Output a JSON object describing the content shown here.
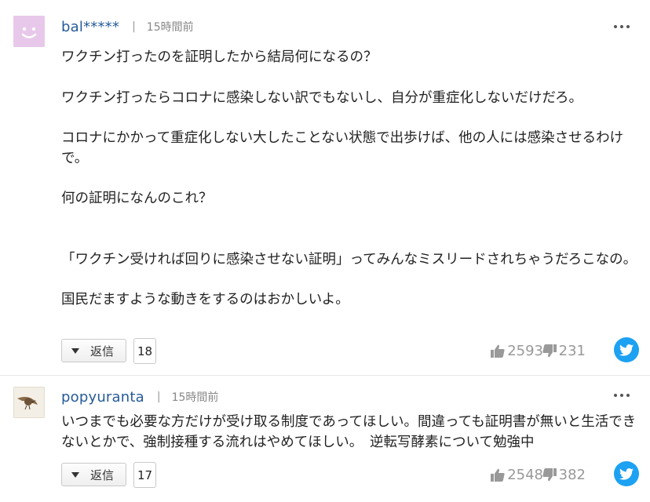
{
  "comments": [
    {
      "username": "bal*****",
      "separator": "|",
      "time": "15時間前",
      "paragraphs": [
        "ワクチン打ったのを証明したから結局何になるの？",
        "ワクチン打ったらコロナに感染しない訳でもないし、自分が重症化しないだけだろ。",
        "コロナにかかって重症化しない大したことない状態で出歩けば、他の人には感染させるわけで。",
        "何の証明になんのこれ？",
        "「ワクチン受ければ回りに感染させない証明」ってみんなミスリードされちゃうだろこなの。",
        "国民だますような動きをするのはおかしいよ。"
      ],
      "reply_label": "返信",
      "reply_count": "18",
      "likes": "2593",
      "dislikes": "231"
    },
    {
      "username": "popyuranta",
      "separator": "|",
      "time": "15時間前",
      "paragraphs": [
        "いつまでも必要な方だけが受け取る制度であってほしい。間違っても証明書が無いと生活できないとかで、強制接種する流れはやめてほしい。　逆転写酵素について勉強中"
      ],
      "reply_label": "返信",
      "reply_count": "17",
      "likes": "2548",
      "dislikes": "382"
    }
  ],
  "icons": {
    "avatar_1": "smiley-face-icon",
    "avatar_2": "bird-icon",
    "more": "more-dots-icon",
    "reply": "triangle-down-icon",
    "like": "thumbs-up-icon",
    "dislike": "thumbs-down-icon",
    "share": "twitter-bird-icon"
  },
  "colors": {
    "username": "#255b9a",
    "twitter": "#1da1f2",
    "avatar_1_bg": "#e7c8ea",
    "vote_text": "#999999"
  }
}
